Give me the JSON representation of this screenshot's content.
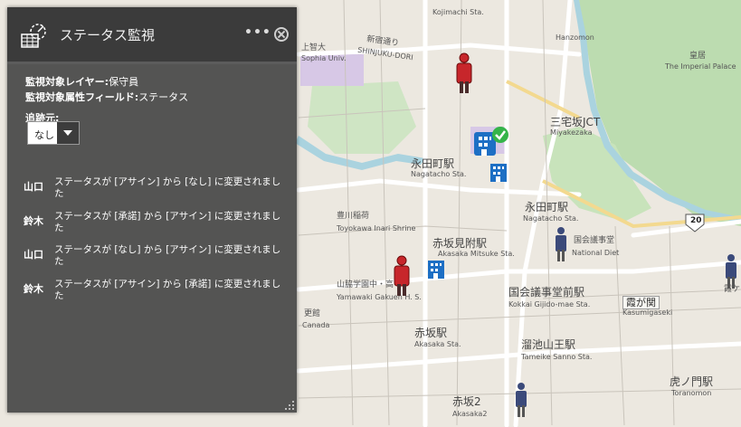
{
  "panel": {
    "title": "ステータス監視",
    "more_label": "•••",
    "layer_label": "監視対象レイヤー:",
    "layer_value": "保守員",
    "field_label": "監視対象属性フィールド:",
    "field_value": "ステータス",
    "follow_label": "追跡元:",
    "follow_value": "なし",
    "logs": [
      {
        "who": "山口",
        "msg": "ステータスが [アサイン] から [なし] に変更されました"
      },
      {
        "who": "鈴木",
        "msg": "ステータスが [承諾] から [アサイン] に変更されました"
      },
      {
        "who": "山口",
        "msg": "ステータスが [なし] から [アサイン] に変更されました"
      },
      {
        "who": "鈴木",
        "msg": "ステータスが [アサイン] から [承諾] に変更されました"
      }
    ]
  },
  "map": {
    "labels": {
      "kojimachi_en": "Kojimachi Sta.",
      "hanzomon_en": "Hanzomon",
      "kokyo": "皇居",
      "imperial_palace": "The Imperial Palace",
      "kamiochiai": "上智大",
      "sophia": "Sophia Univ.",
      "shinjuku_dori": "新宿通り",
      "shinjuku_dori_en": "SHINJUKU-DORI",
      "miyakezaka": "三宅坂JCT",
      "miyakezaka_en": "Miyakezaka",
      "nagatacho": "永田町駅",
      "nagatacho_en": "Nagatacho Sta.",
      "nagatacho2": "永田町駅",
      "nagatacho2_en": "Nagatacho Sta.",
      "toyokawa": "豊川稲荷",
      "toyokawa_en": "Toyokawa Inari Shrine",
      "akasakamitsuke": "赤坂見附駅",
      "akasakamitsuke_en": "Akasaka Mitsuke Sta.",
      "kokkai": "国会議事堂",
      "national_diet": "National Diet",
      "kokkaigijido": "国会議事堂前駅",
      "kokkaigijido_en": "Kokkai Gijido-mae Sta.",
      "kasumigaseki": "霞が関",
      "kasumigaseki_en": "Kasumigaseki",
      "yamawaki": "山脇学園中・高",
      "yamawaki_en": "Yamawaki Gakuen H. S.",
      "canada": "Canada",
      "akasaka": "赤坂駅",
      "akasaka_en": "Akasaka Sta.",
      "tameike": "溜池山王駅",
      "tameike_en": "Tameike Sanno Sta.",
      "akasaka2": "赤坂2",
      "akasaka2_en": "Akasaka2",
      "toranomon": "虎ノ門駅",
      "toranomon_en": "Toranomon",
      "route20": "20",
      "kasumi_right": "霞ケ",
      "ebi": "更館"
    }
  }
}
